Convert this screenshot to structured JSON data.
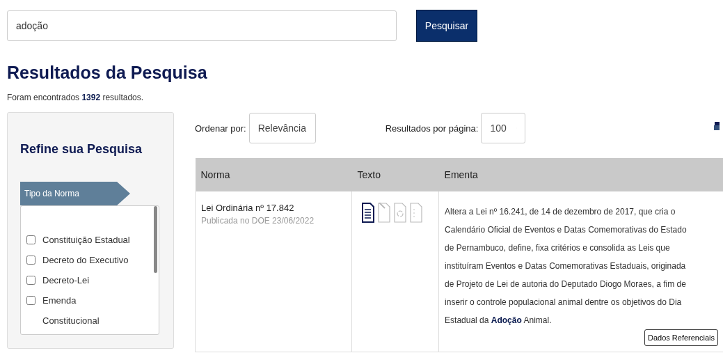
{
  "search": {
    "value": "adoção",
    "button": "Pesquisar"
  },
  "heading": "Resultados da Pesquisa",
  "result_count": "Foram encontrados **1392** resultados.",
  "sidebar": {
    "title": "Refine sua Pesquisa",
    "filter_title": "Tipo da Norma",
    "options": [
      {
        "label": "Constituição Estadual",
        "checked": false
      },
      {
        "label": "Decreto do Executivo",
        "checked": false
      },
      {
        "label": "Decreto-Lei",
        "checked": false
      },
      {
        "label": "Emenda Constitucional",
        "checked": false
      }
    ]
  },
  "sort": {
    "label": "Ordenar por:",
    "value": "Relevância"
  },
  "per_page": {
    "label": "Resultados por página:",
    "value": "100"
  },
  "table": {
    "columns": [
      "Norma",
      "Texto",
      "Ementa"
    ],
    "rows": [
      {
        "norma": "Lei Ordinária nº 17.842",
        "published": "Publicada no DOE 23/06/2022",
        "texto_icons": [
          {
            "kind": "text",
            "enabled": true
          },
          {
            "kind": "edit",
            "enabled": false
          },
          {
            "kind": "compiled",
            "enabled": false
          },
          {
            "kind": "numbered",
            "enabled": false
          }
        ],
        "ementa": "Altera a Lei nº 16.241, de 14 de dezembro de 2017, que cria o Calendário Oficial de Eventos e Datas Comemorativas do Estado de Pernambuco, define, fixa critérios e consolida as Leis que instituíram Eventos e Datas Comemorativas Estaduais, originada de Projeto de Lei de autoria do Deputado Diogo Moraes, a fim de inserir o controle populacional animal dentre os objetivos do Dia Estadual da **Adoção** Animal.",
        "button": "Dados Referenciais"
      }
    ]
  }
}
